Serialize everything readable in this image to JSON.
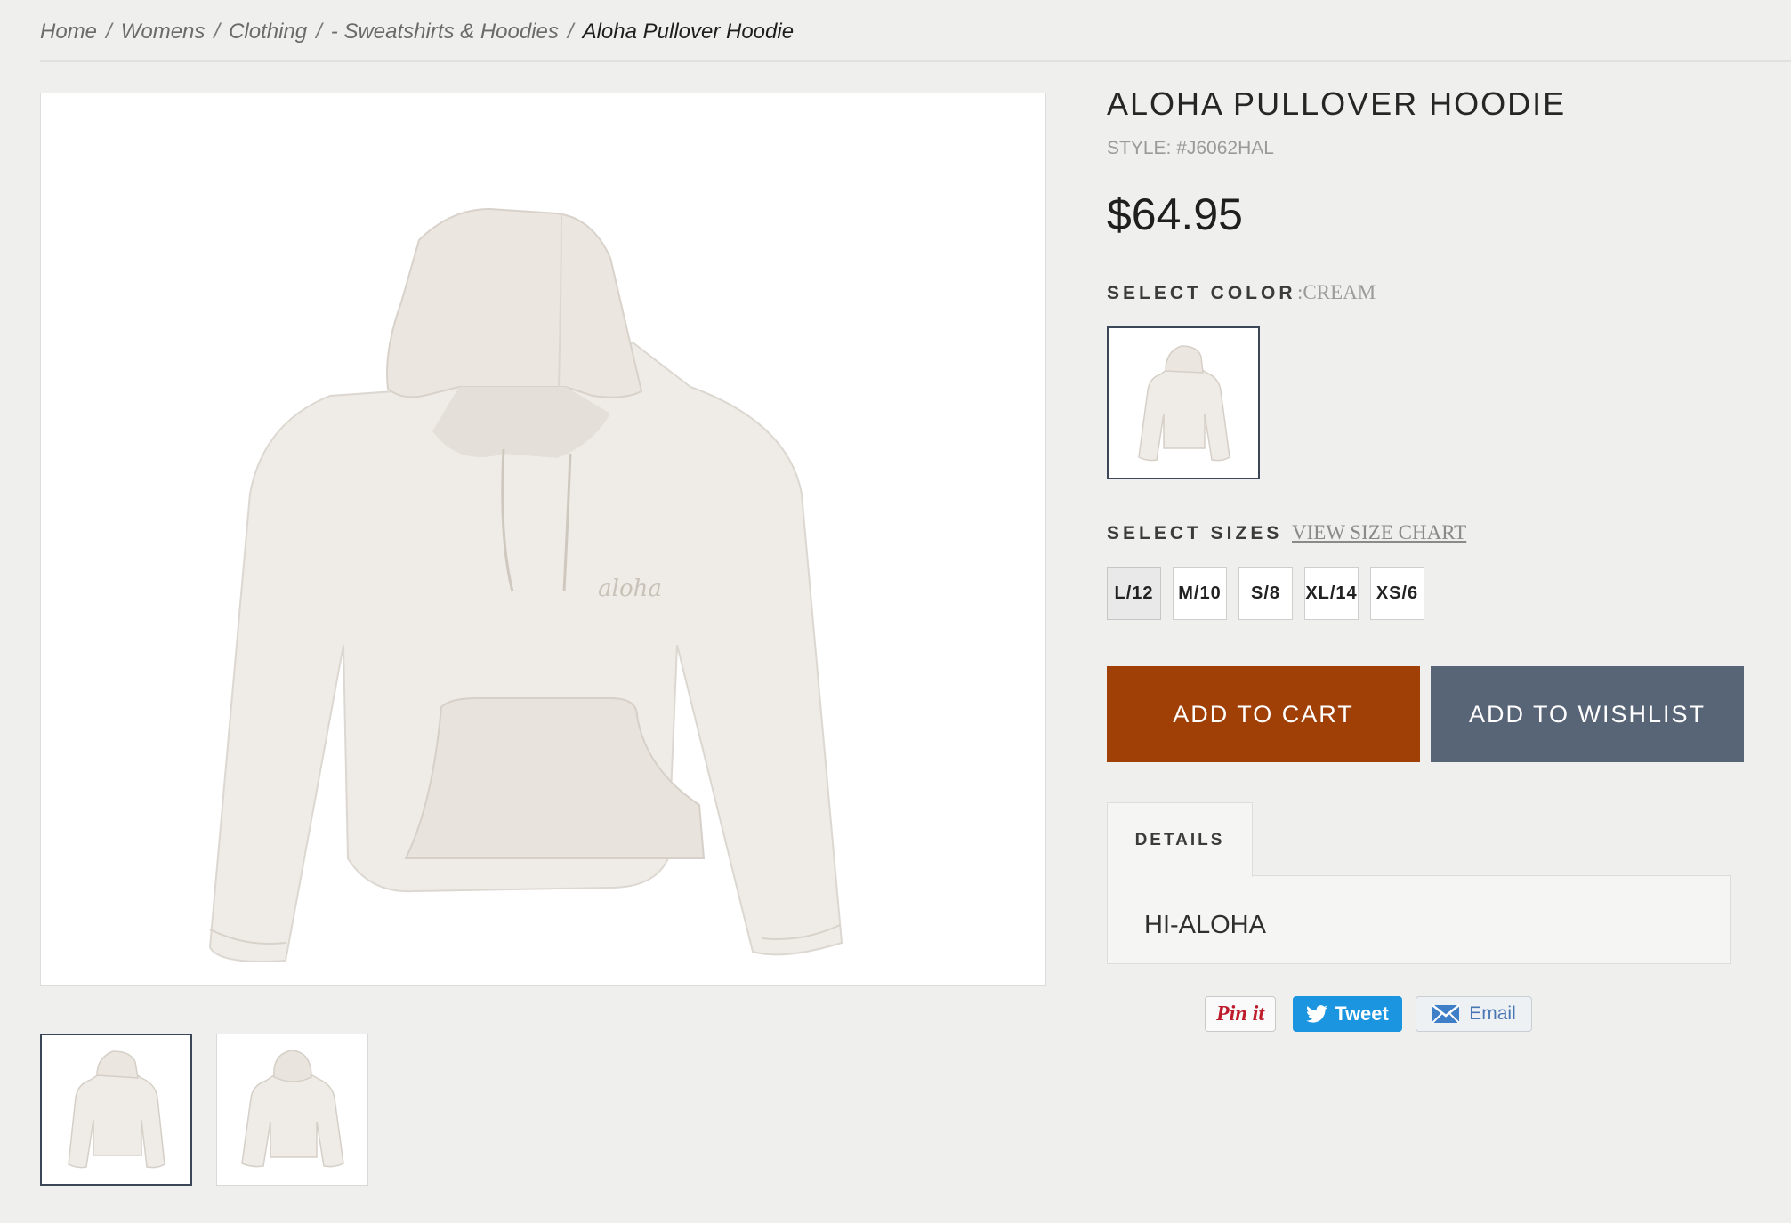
{
  "breadcrumb": {
    "items": [
      "Home",
      "Womens",
      "Clothing",
      "- Sweatshirts & Hoodies"
    ],
    "separator": "/",
    "current": "Aloha Pullover Hoodie"
  },
  "product": {
    "title": "ALOHA PULLOVER HOODIE",
    "style": "STYLE: #J6062HAL",
    "price": "$64.95",
    "print_text": "aloha"
  },
  "color": {
    "label": "SELECT COLOR",
    "value": ":CREAM"
  },
  "sizes": {
    "label": "SELECT SIZES",
    "chart_link": "VIEW SIZE CHART",
    "options": [
      "L/12",
      "M/10",
      "S/8",
      "XL/14",
      "XS/6"
    ],
    "selected": "L/12"
  },
  "actions": {
    "add_to_cart": "ADD TO CART",
    "add_to_wishlist": "ADD TO WISHLIST"
  },
  "details": {
    "tab": "DETAILS",
    "text": "HI-ALOHA"
  },
  "share": {
    "pin": "Pin it",
    "tweet": "Tweet",
    "email": "Email"
  },
  "colors": {
    "cart": "#a04006",
    "wishlist": "#586577",
    "selected_border": "#3b4658",
    "hoodie": "#efebe6"
  },
  "icons": [
    "twitter-bird-icon",
    "envelope-icon"
  ]
}
